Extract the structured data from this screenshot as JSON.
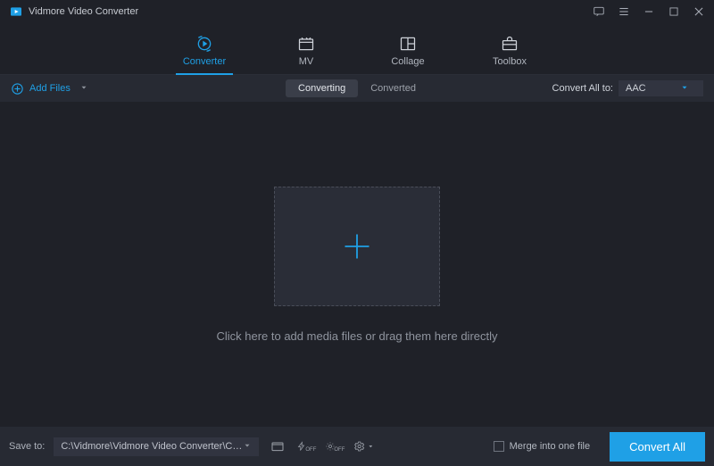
{
  "app": {
    "title": "Vidmore Video Converter"
  },
  "nav": {
    "tabs": [
      {
        "label": "Converter"
      },
      {
        "label": "MV"
      },
      {
        "label": "Collage"
      },
      {
        "label": "Toolbox"
      }
    ]
  },
  "toolbar": {
    "add_files": "Add Files",
    "subtabs": {
      "converting": "Converting",
      "converted": "Converted"
    },
    "convert_all_label": "Convert All to:",
    "format_selected": "AAC"
  },
  "dropzone": {
    "hint": "Click here to add media files or drag them here directly"
  },
  "footer": {
    "save_to_label": "Save to:",
    "save_path": "C:\\Vidmore\\Vidmore Video Converter\\Converted",
    "merge_label": "Merge into one file",
    "convert_button": "Convert All"
  }
}
